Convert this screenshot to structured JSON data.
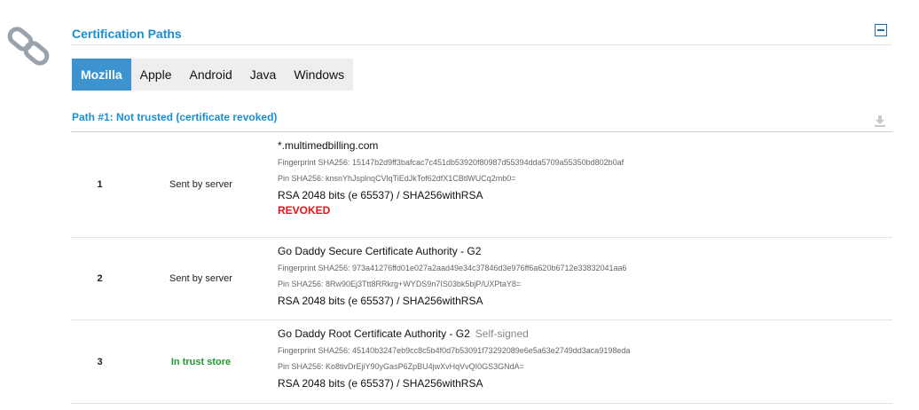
{
  "section": {
    "title": "Certification Paths"
  },
  "tabs": [
    {
      "label": "Mozilla",
      "active": true
    },
    {
      "label": "Apple",
      "active": false
    },
    {
      "label": "Android",
      "active": false
    },
    {
      "label": "Java",
      "active": false
    },
    {
      "label": "Windows",
      "active": false
    }
  ],
  "path": {
    "header": "Path #1: Not trusted (certificate revoked)",
    "certs": [
      {
        "num": "1",
        "source": "Sent by server",
        "subject": "*.multimedbilling.com",
        "self_signed": "",
        "fingerprint": "Fingerprint SHA256: 15147b2d9ff3bafcac7c451db53920f80987d55394dda5709a55350bd802b0af",
        "pin": "Pin SHA256: knsnYhJsplnqCVlqTiEdJkTof62dfX1CBtlWUCq2mb0=",
        "key": "RSA 2048 bits (e 65537) / SHA256withRSA",
        "status": "REVOKED"
      },
      {
        "num": "2",
        "source": "Sent by server",
        "subject": "Go Daddy Secure Certificate Authority - G2",
        "self_signed": "",
        "fingerprint": "Fingerprint SHA256: 973a41276ffd01e027a2aad49e34c37846d3e976ff6a620b6712e33832041aa6",
        "pin": "Pin SHA256: 8Rw90Ej3Ttt8RRkrg+WYDS9n7IS03bk5bjP/UXPtaY8=",
        "key": "RSA 2048 bits (e 65537) / SHA256withRSA",
        "status": ""
      },
      {
        "num": "3",
        "source": "In trust store",
        "subject": "Go Daddy Root Certificate Authority - G2",
        "self_signed": "Self-signed",
        "fingerprint": "Fingerprint SHA256: 45140b3247eb9cc8c5b4f0d7b53091f73292089e6e5a63e2749dd3aca9198eda",
        "pin": "Pin SHA256: Ko8tivDrEjiY90yGasP6ZpBU4jwXvHqVvQI0GS3GNdA=",
        "key": "RSA 2048 bits (e 65537) / SHA256withRSA",
        "status": ""
      }
    ]
  },
  "colors": {
    "accent": "#1a8fd0",
    "tab_active": "#3c93cf",
    "revoked": "#e0141a",
    "trust": "#1e9a2e"
  },
  "icons": {
    "section": "chain-link-icon",
    "collapse": "collapse-minus-icon",
    "download": "download-icon"
  }
}
